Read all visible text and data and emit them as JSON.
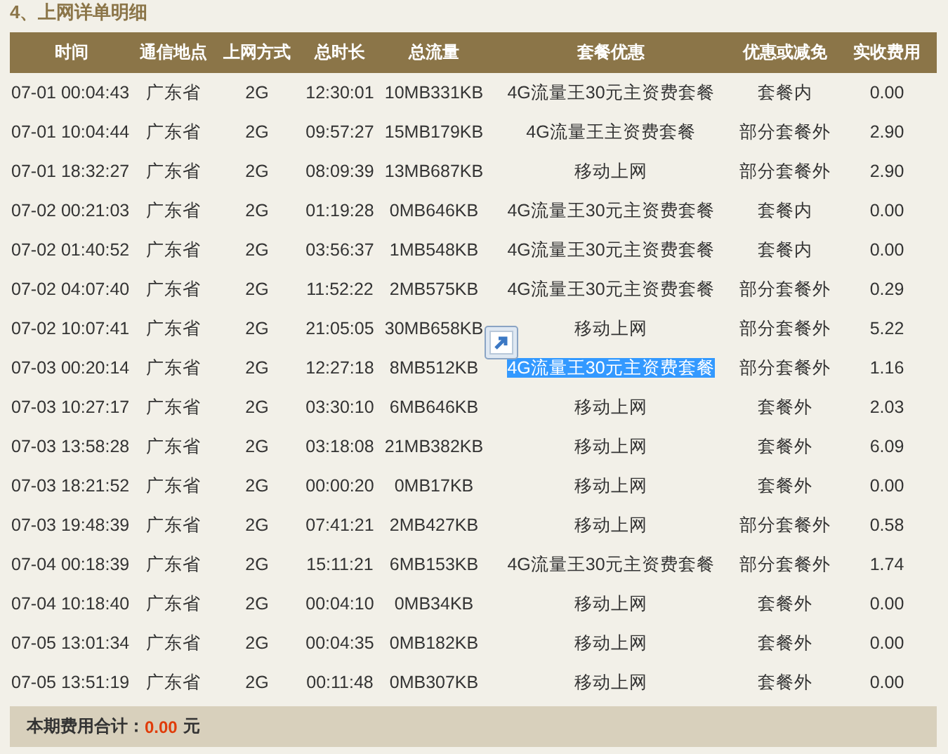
{
  "section_title": "4、上网详单明细",
  "table": {
    "columns": [
      "时间",
      "通信地点",
      "上网方式",
      "总时长",
      "总流量",
      "套餐优惠",
      "优惠或减免",
      "实收费用"
    ],
    "rows": [
      {
        "time": "07-01 00:04:43",
        "location": "广东省",
        "mode": "2G",
        "duration": "12:30:01",
        "traffic": "10MB331KB",
        "package": "4G流量王30元主资费套餐",
        "package_selected": false,
        "discount": "套餐内",
        "fee": "0.00"
      },
      {
        "time": "07-01 10:04:44",
        "location": "广东省",
        "mode": "2G",
        "duration": "09:57:27",
        "traffic": "15MB179KB",
        "package": "4G流量王主资费套餐",
        "package_selected": false,
        "discount": "部分套餐外",
        "fee": "2.90"
      },
      {
        "time": "07-01 18:32:27",
        "location": "广东省",
        "mode": "2G",
        "duration": "08:09:39",
        "traffic": "13MB687KB",
        "package": "移动上网",
        "package_selected": false,
        "discount": "部分套餐外",
        "fee": "2.90"
      },
      {
        "time": "07-02 00:21:03",
        "location": "广东省",
        "mode": "2G",
        "duration": "01:19:28",
        "traffic": "0MB646KB",
        "package": "4G流量王30元主资费套餐",
        "package_selected": false,
        "discount": "套餐内",
        "fee": "0.00"
      },
      {
        "time": "07-02 01:40:52",
        "location": "广东省",
        "mode": "2G",
        "duration": "03:56:37",
        "traffic": "1MB548KB",
        "package": "4G流量王30元主资费套餐",
        "package_selected": false,
        "discount": "套餐内",
        "fee": "0.00"
      },
      {
        "time": "07-02 04:07:40",
        "location": "广东省",
        "mode": "2G",
        "duration": "11:52:22",
        "traffic": "2MB575KB",
        "package": "4G流量王30元主资费套餐",
        "package_selected": false,
        "discount": "部分套餐外",
        "fee": "0.29"
      },
      {
        "time": "07-02 10:07:41",
        "location": "广东省",
        "mode": "2G",
        "duration": "21:05:05",
        "traffic": "30MB658KB",
        "package": "移动上网",
        "package_selected": false,
        "discount": "部分套餐外",
        "fee": "5.22"
      },
      {
        "time": "07-03 00:20:14",
        "location": "广东省",
        "mode": "2G",
        "duration": "12:27:18",
        "traffic": "8MB512KB",
        "package": "4G流量王30元主资费套餐",
        "package_selected": true,
        "discount": "部分套餐外",
        "fee": "1.16"
      },
      {
        "time": "07-03 10:27:17",
        "location": "广东省",
        "mode": "2G",
        "duration": "03:30:10",
        "traffic": "6MB646KB",
        "package": "移动上网",
        "package_selected": false,
        "discount": "套餐外",
        "fee": "2.03"
      },
      {
        "time": "07-03 13:58:28",
        "location": "广东省",
        "mode": "2G",
        "duration": "03:18:08",
        "traffic": "21MB382KB",
        "package": "移动上网",
        "package_selected": false,
        "discount": "套餐外",
        "fee": "6.09"
      },
      {
        "time": "07-03 18:21:52",
        "location": "广东省",
        "mode": "2G",
        "duration": "00:00:20",
        "traffic": "0MB17KB",
        "package": "移动上网",
        "package_selected": false,
        "discount": "套餐外",
        "fee": "0.00"
      },
      {
        "time": "07-03 19:48:39",
        "location": "广东省",
        "mode": "2G",
        "duration": "07:41:21",
        "traffic": "2MB427KB",
        "package": "移动上网",
        "package_selected": false,
        "discount": "部分套餐外",
        "fee": "0.58"
      },
      {
        "time": "07-04 00:18:39",
        "location": "广东省",
        "mode": "2G",
        "duration": "15:11:21",
        "traffic": "6MB153KB",
        "package": "4G流量王30元主资费套餐",
        "package_selected": false,
        "discount": "部分套餐外",
        "fee": "1.74"
      },
      {
        "time": "07-04 10:18:40",
        "location": "广东省",
        "mode": "2G",
        "duration": "00:04:10",
        "traffic": "0MB34KB",
        "package": "移动上网",
        "package_selected": false,
        "discount": "套餐外",
        "fee": "0.00"
      },
      {
        "time": "07-05 13:01:34",
        "location": "广东省",
        "mode": "2G",
        "duration": "00:04:35",
        "traffic": "0MB182KB",
        "package": "移动上网",
        "package_selected": false,
        "discount": "套餐外",
        "fee": "0.00"
      },
      {
        "time": "07-05 13:51:19",
        "location": "广东省",
        "mode": "2G",
        "duration": "00:11:48",
        "traffic": "0MB307KB",
        "package": "移动上网",
        "package_selected": false,
        "discount": "套餐外",
        "fee": "0.00"
      }
    ]
  },
  "total": {
    "label": "本期费用合计：",
    "amount": "0.00",
    "unit": "元"
  }
}
